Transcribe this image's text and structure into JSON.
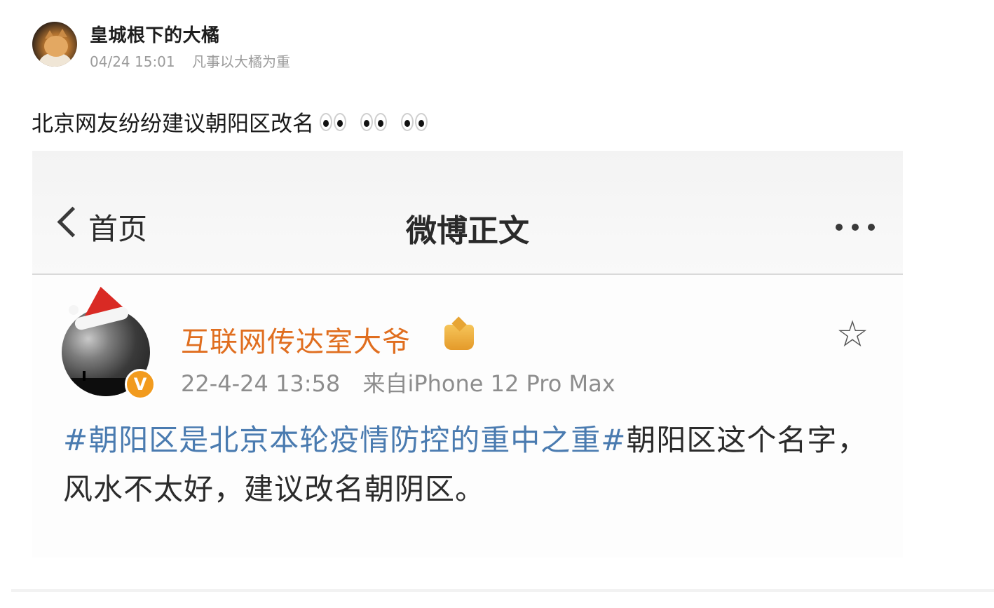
{
  "post": {
    "user_name": "皇城根下的大橘",
    "time": "04/24 15:01",
    "signature": "凡事以大橘为重",
    "text": "北京网友纷纷建议朝阳区改名",
    "emoji": "eyes"
  },
  "screenshot": {
    "nav": {
      "back_label": "首页",
      "title": "微博正文",
      "more_icon": "more-dots-icon"
    },
    "author": {
      "name": "互联网传达室大爷",
      "verified_badge": "V",
      "time": "22-4-24 13:58",
      "source": "来自iPhone 12 Pro Max"
    },
    "body": {
      "topic": "#朝阳区是北京本轮疫情防控的重中之重#",
      "text": "朝阳区这个名字，风水不太好，建议改名朝阴区。"
    },
    "colors": {
      "author_name": "#e06e1f",
      "topic": "#4a7bb0",
      "verified_badge": "#f29b1e"
    }
  }
}
